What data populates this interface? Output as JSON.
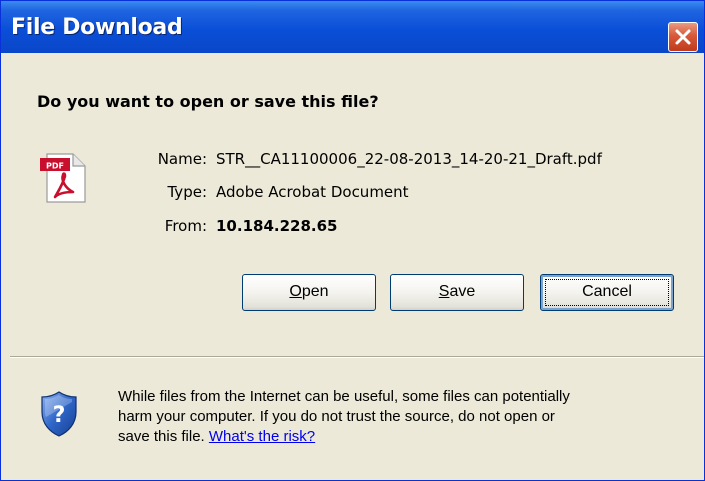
{
  "window": {
    "title": "File Download"
  },
  "prompt": {
    "question": "Do you want to open or save this file?"
  },
  "file": {
    "icon": "pdf-file-icon",
    "name_label": "Name:",
    "name_value": "STR__CA11100006_22-08-2013_14-20-21_Draft.pdf",
    "type_label": "Type:",
    "type_value": "Adobe Acrobat Document",
    "from_label": "From:",
    "from_value": "10.184.228.65"
  },
  "buttons": {
    "open_label": "Open",
    "save_label": "Save",
    "cancel_label": "Cancel"
  },
  "warning": {
    "icon": "shield-question-icon",
    "line1": "While files from the Internet can be useful, some files can potentially",
    "line2": "harm your computer. If you do not trust the source, do not open or",
    "line3_prefix": "save this file.",
    "risk_link": "What's the risk?"
  },
  "colors": {
    "titlebar": "#0a4fd8",
    "dialog_bg": "#ece9d8",
    "close_button": "#d8593a",
    "link": "#0000ee"
  }
}
